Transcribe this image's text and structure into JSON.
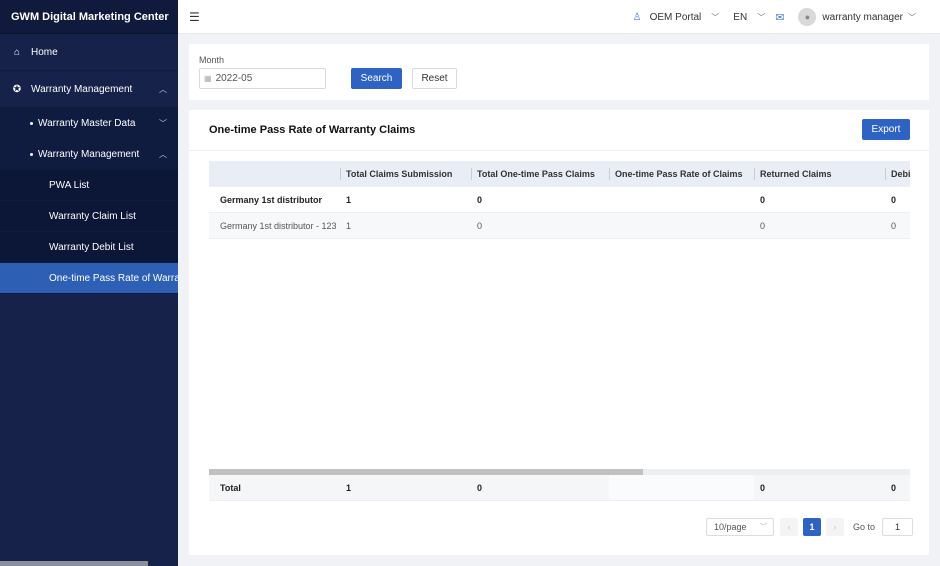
{
  "app": {
    "title": "GWM Digital Marketing Center"
  },
  "sidebar": {
    "home": {
      "label": "Home",
      "icon": "home-icon"
    },
    "warranty_group": {
      "label": "Warranty Management",
      "icon": "circle-settings-icon"
    },
    "master_data": {
      "label": "Warranty Master Data"
    },
    "warranty_sub": {
      "label": "Warranty Management"
    },
    "items": [
      {
        "label": "PWA List"
      },
      {
        "label": "Warranty Claim List"
      },
      {
        "label": "Warranty Debit List"
      },
      {
        "label": "One-time Pass Rate of Warranty Claims",
        "active": true
      }
    ]
  },
  "topbar": {
    "portal": "OEM Portal",
    "language": "EN",
    "user": "warranty manager"
  },
  "filter": {
    "month_label": "Month",
    "month_value": "2022-05",
    "search_label": "Search",
    "reset_label": "Reset"
  },
  "table_card": {
    "title": "One-time Pass Rate of Warranty Claims",
    "export_label": "Export",
    "columns": [
      "",
      "Total Claims Submission",
      "Total One-time Pass Claims",
      "One-time Pass Rate of Claims",
      "Returned Claims",
      "Debit"
    ],
    "rows": [
      [
        "Germany 1st distributor",
        "1",
        "0",
        "",
        "0",
        "0"
      ],
      [
        "Germany 1st distributor - 123",
        "1",
        "0",
        "",
        "0",
        "0"
      ]
    ],
    "footer": [
      "Total",
      "1",
      "0",
      "",
      "0",
      "0"
    ]
  },
  "pagination": {
    "page_size": "10/page",
    "current_page": "1",
    "goto_label": "Go to",
    "goto_value": "1"
  },
  "colors": {
    "sidebar_bg": "#16224a",
    "accent": "#2f63c3",
    "active_item": "#2d5fb5"
  }
}
